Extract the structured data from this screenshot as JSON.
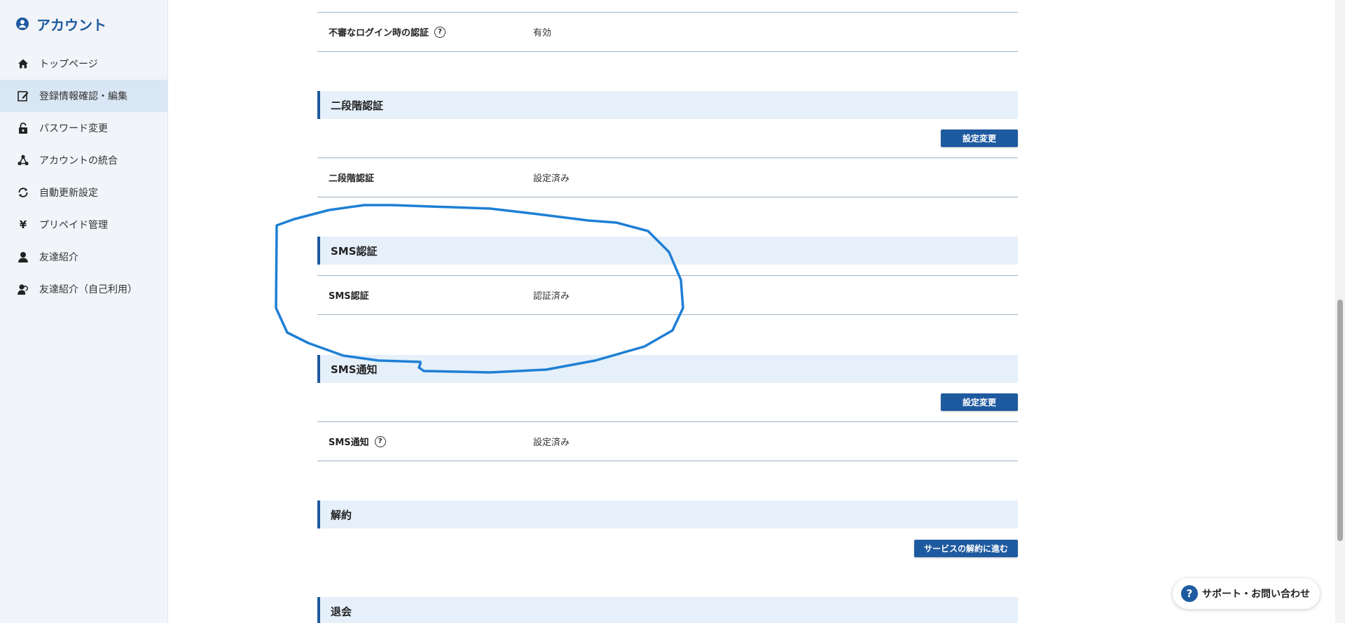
{
  "sidebar": {
    "title": "アカウント",
    "items": [
      {
        "label": "トップページ",
        "icon": "home-icon"
      },
      {
        "label": "登録情報確認・編集",
        "icon": "edit-icon",
        "active": true
      },
      {
        "label": "パスワード変更",
        "icon": "lock-icon"
      },
      {
        "label": "アカウントの統合",
        "icon": "merge-icon"
      },
      {
        "label": "自動更新設定",
        "icon": "refresh-icon"
      },
      {
        "label": "プリペイド管理",
        "icon": "yen-icon"
      },
      {
        "label": "友達紹介",
        "icon": "user-icon"
      },
      {
        "label": "友達紹介（自己利用）",
        "icon": "user-return-icon"
      }
    ]
  },
  "main": {
    "suspicious_login": {
      "label": "不審なログイン時の認証",
      "value": "有効"
    },
    "two_factor": {
      "heading": "二段階認証",
      "button": "設定変更",
      "label": "二段階認証",
      "value": "設定済み"
    },
    "sms_auth": {
      "heading": "SMS認証",
      "label": "SMS認証",
      "value": "認証済み"
    },
    "sms_notify": {
      "heading": "SMS通知",
      "button": "設定変更",
      "label": "SMS通知",
      "value": "設定済み"
    },
    "cancel": {
      "heading": "解約",
      "button": "サービスの解約に進む"
    },
    "withdraw": {
      "heading": "退会"
    }
  },
  "support": {
    "label": "サポート・お問い合わせ",
    "icon": "question-icon"
  },
  "colors": {
    "accent": "#1e5aa0",
    "section_bg": "#e5f0fa",
    "annotation": "#1e7fd4"
  }
}
